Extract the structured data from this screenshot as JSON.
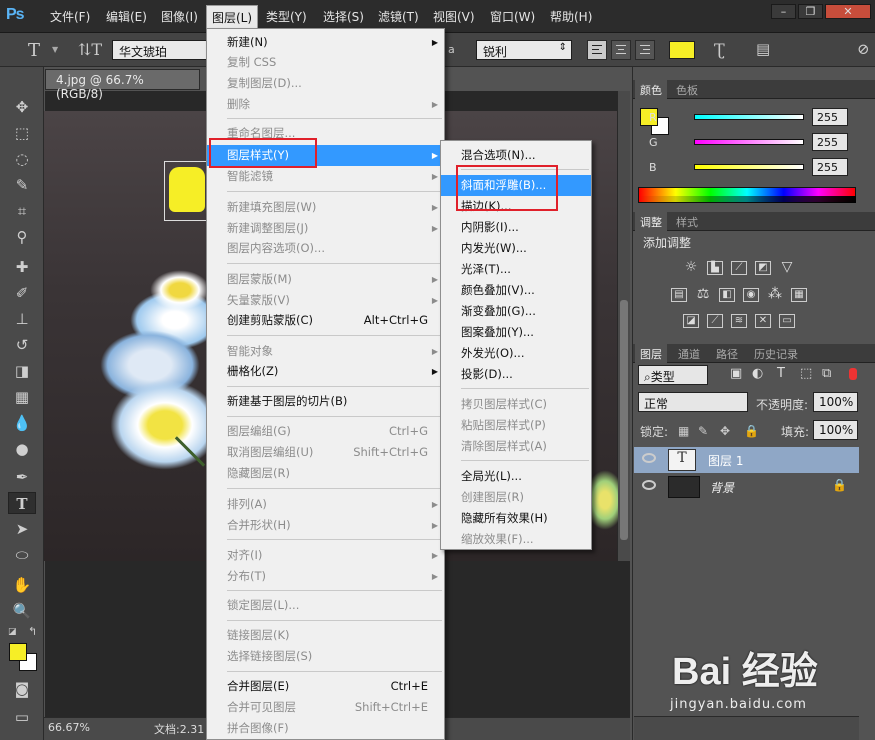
{
  "app": {
    "logo": "Ps"
  },
  "menubar": {
    "items": [
      "文件(F)",
      "编辑(E)",
      "图像(I)",
      "图层(L)",
      "类型(Y)",
      "选择(S)",
      "滤镜(T)",
      "视图(V)",
      "窗口(W)",
      "帮助(H)"
    ],
    "active": "图层(L)"
  },
  "options_bar": {
    "font_family": "华文琥珀",
    "aa_label": "a",
    "anti_alias": "锐利",
    "text_color": "#f6ee26"
  },
  "document": {
    "tab_title": "4.jpg @ 66.7%(RGB/8)",
    "zoom": "66.67%",
    "doc_info": "文档:2.31"
  },
  "layer_menu": {
    "items": [
      {
        "label": "新建(N)",
        "disabled": false,
        "submenu": true
      },
      {
        "label": "复制 CSS",
        "disabled": true
      },
      {
        "label": "复制图层(D)...",
        "disabled": true
      },
      {
        "label": "删除",
        "disabled": true,
        "submenu": true
      },
      {
        "label": "重命名图层...",
        "disabled": true
      },
      {
        "label": "图层样式(Y)",
        "disabled": false,
        "submenu": true,
        "highlighted": true
      },
      {
        "label": "智能滤镜",
        "disabled": true,
        "submenu": true
      },
      {
        "label": "新建填充图层(W)",
        "disabled": true,
        "submenu": true
      },
      {
        "label": "新建调整图层(J)",
        "disabled": true,
        "submenu": true
      },
      {
        "label": "图层内容选项(O)...",
        "disabled": true
      },
      {
        "label": "图层蒙版(M)",
        "disabled": true,
        "submenu": true
      },
      {
        "label": "矢量蒙版(V)",
        "disabled": true,
        "submenu": true
      },
      {
        "label": "创建剪贴蒙版(C)",
        "disabled": false,
        "shortcut": "Alt+Ctrl+G"
      },
      {
        "label": "智能对象",
        "disabled": true,
        "submenu": true
      },
      {
        "label": "栅格化(Z)",
        "disabled": false,
        "submenu": true
      },
      {
        "label": "新建基于图层的切片(B)",
        "disabled": false
      },
      {
        "label": "图层编组(G)",
        "disabled": true,
        "shortcut": "Ctrl+G"
      },
      {
        "label": "取消图层编组(U)",
        "disabled": true,
        "shortcut": "Shift+Ctrl+G"
      },
      {
        "label": "隐藏图层(R)",
        "disabled": true
      },
      {
        "label": "排列(A)",
        "disabled": true,
        "submenu": true
      },
      {
        "label": "合并形状(H)",
        "disabled": true,
        "submenu": true
      },
      {
        "label": "对齐(I)",
        "disabled": true,
        "submenu": true
      },
      {
        "label": "分布(T)",
        "disabled": true,
        "submenu": true
      },
      {
        "label": "锁定图层(L)...",
        "disabled": true
      },
      {
        "label": "链接图层(K)",
        "disabled": true
      },
      {
        "label": "选择链接图层(S)",
        "disabled": true
      },
      {
        "label": "合并图层(E)",
        "disabled": false,
        "shortcut": "Ctrl+E"
      },
      {
        "label": "合并可见图层",
        "disabled": true,
        "shortcut": "Shift+Ctrl+E"
      },
      {
        "label": "拼合图像(F)",
        "disabled": true
      }
    ]
  },
  "style_submenu": {
    "items": [
      {
        "label": "混合选项(N)...",
        "disabled": false
      },
      {
        "label": "斜面和浮雕(B)...",
        "disabled": false,
        "highlighted": true
      },
      {
        "label": "描边(K)...",
        "disabled": false
      },
      {
        "label": "内阴影(I)...",
        "disabled": false
      },
      {
        "label": "内发光(W)...",
        "disabled": false
      },
      {
        "label": "光泽(T)...",
        "disabled": false
      },
      {
        "label": "颜色叠加(V)...",
        "disabled": false
      },
      {
        "label": "渐变叠加(G)...",
        "disabled": false
      },
      {
        "label": "图案叠加(Y)...",
        "disabled": false
      },
      {
        "label": "外发光(O)...",
        "disabled": false
      },
      {
        "label": "投影(D)...",
        "disabled": false
      },
      {
        "label": "拷贝图层样式(C)",
        "disabled": true
      },
      {
        "label": "粘贴图层样式(P)",
        "disabled": true
      },
      {
        "label": "清除图层样式(A)",
        "disabled": true
      },
      {
        "label": "全局光(L)...",
        "disabled": false
      },
      {
        "label": "创建图层(R)",
        "disabled": true
      },
      {
        "label": "隐藏所有效果(H)",
        "disabled": false
      },
      {
        "label": "缩放效果(F)...",
        "disabled": true
      }
    ]
  },
  "color_panel": {
    "tabs": [
      "颜色",
      "色板"
    ],
    "channels": [
      {
        "label": "R",
        "value": "255"
      },
      {
        "label": "G",
        "value": "255"
      },
      {
        "label": "B",
        "value": "255"
      }
    ]
  },
  "adjust_panel": {
    "tabs": [
      "调整",
      "样式"
    ],
    "title": "添加调整"
  },
  "layers_panel": {
    "tabs": [
      "图层",
      "通道",
      "路径",
      "历史记录"
    ],
    "filter": "类型",
    "blend_mode": "正常",
    "opacity_label": "不透明度:",
    "opacity": "100%",
    "lock_label": "锁定:",
    "fill_label": "填充:",
    "fill": "100%",
    "layers": [
      {
        "name": "图层 1",
        "type": "text",
        "selected": true
      },
      {
        "name": "背景",
        "type": "image",
        "locked": true
      }
    ]
  },
  "watermark": {
    "brand": "Bai 经验",
    "url": "jingyan.baidu.com"
  }
}
